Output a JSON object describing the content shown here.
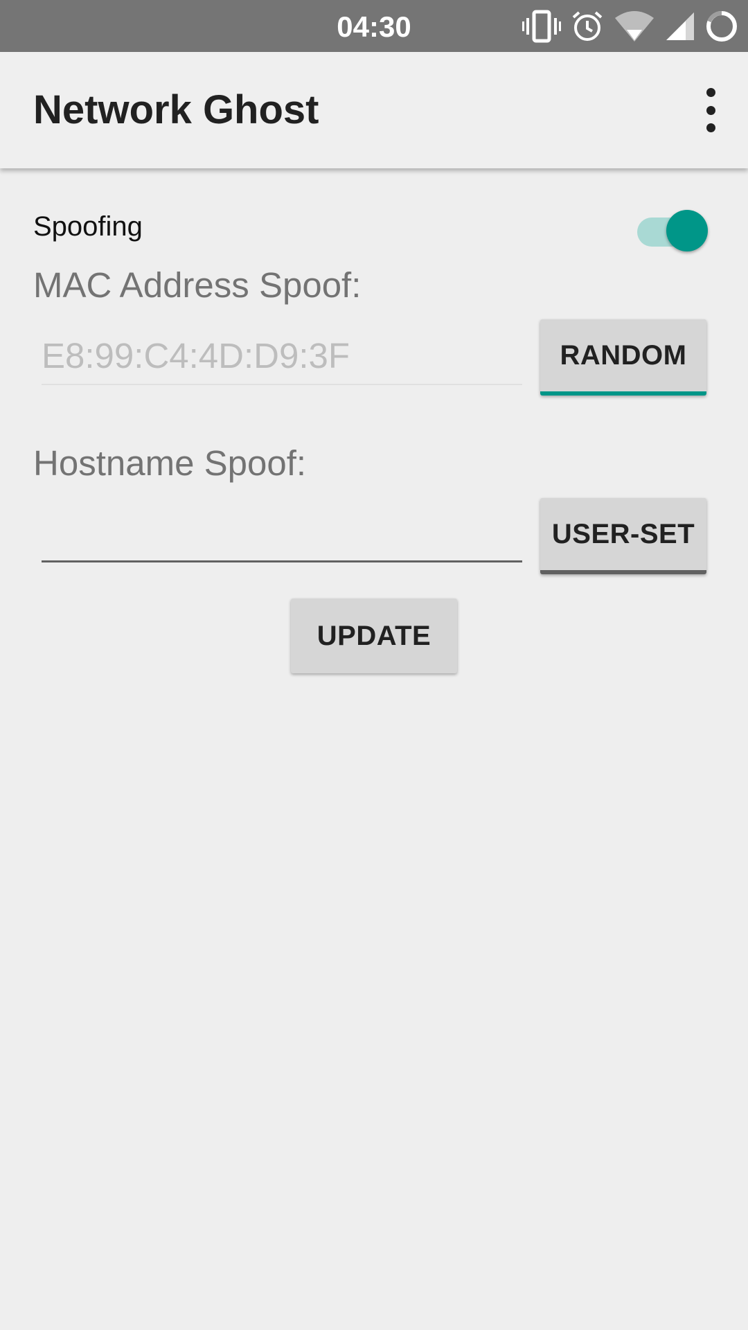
{
  "status_bar": {
    "time": "04:30",
    "icons": [
      "vibrate-icon",
      "alarm-icon",
      "wifi-icon",
      "cell-signal-icon",
      "sync-circle-icon"
    ]
  },
  "app_bar": {
    "title": "Network Ghost",
    "menu_icon": "more-vert-icon"
  },
  "main": {
    "spoofing_label": "Spoofing",
    "spoofing_enabled": true,
    "mac_label": "MAC Address Spoof:",
    "mac_placeholder": "E8:99:C4:4D:D9:3F",
    "random_button": "RANDOM",
    "hostname_label": "Hostname Spoof:",
    "hostname_value": "",
    "userset_button": "USER-SET",
    "update_button": "UPDATE"
  },
  "colors": {
    "accent": "#009688",
    "switch_track": "#a9d9d4",
    "status_bar": "#757575",
    "background": "#eeeeee"
  }
}
